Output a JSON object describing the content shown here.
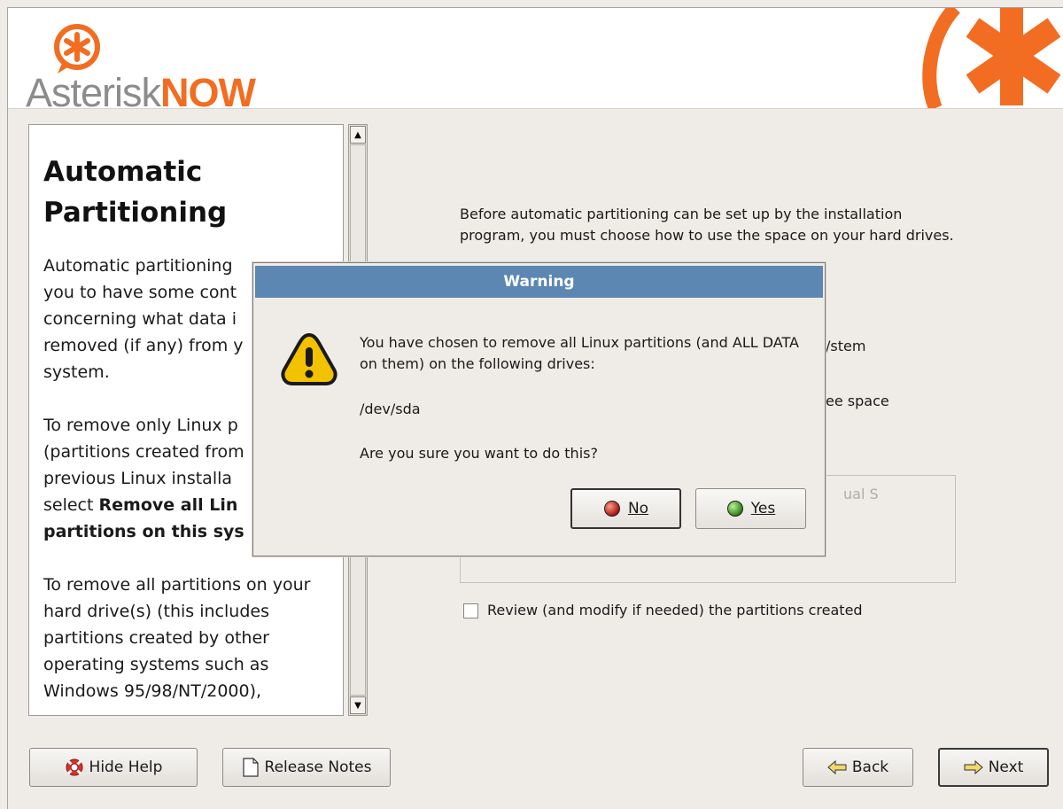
{
  "branding": {
    "logo_text_part1": "Asterisk",
    "logo_text_part2": "NOW"
  },
  "help": {
    "title": "Automatic Partitioning",
    "para1": "Automatic partitioning you to have some cont concerning what data i removed (if any) from y system.",
    "para2_line1": "To remove only Linux p",
    "para2_line2": "(partitions created from",
    "para2_line3": "previous Linux installa",
    "para2_line4_prefix": "select ",
    "para2_line4_bold": "Remove all Lin",
    "para2_line5_bold": "partitions on this sys",
    "para3": "To remove all partitions on your hard drive(s) (this includes partitions created by other operating systems such as Windows 95/98/NT/2000),"
  },
  "main": {
    "intro": "Before automatic partitioning can be set up by the installation program, you must choose how to use the space on your hard drives.",
    "partial_system": "/stem",
    "partial_free_space": "ee space",
    "partial_grey": "ual S",
    "review_label": "Review (and modify if needed) the partitions created"
  },
  "dialog": {
    "title": "Warning",
    "message": "You have chosen to remove all Linux partitions (and ALL DATA on them) on the following drives:",
    "device": "/dev/sda",
    "question": "Are you sure you want to do this?",
    "no_label": "No",
    "yes_label": "Yes"
  },
  "buttons": {
    "hide_help": "Hide Help",
    "release_notes": "Release Notes",
    "back": "Back",
    "next": "Next"
  },
  "colors": {
    "accent_orange": "#f26d21",
    "dialog_title_bg": "#5b87b2",
    "window_bg": "#efebe7"
  },
  "icons": [
    "logo-asterisk-icon",
    "warning-icon",
    "no-red-dot-icon",
    "yes-green-dot-icon",
    "lifebuoy-icon",
    "document-icon",
    "back-arrow-icon",
    "next-arrow-icon"
  ]
}
